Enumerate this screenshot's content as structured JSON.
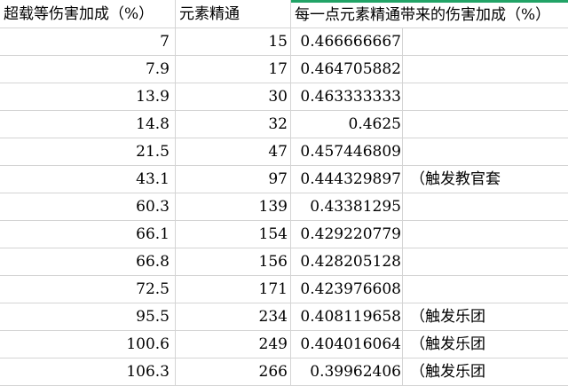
{
  "headers": [
    "超载等伤害加成（%）",
    "元素精通",
    "每一点元素精通带来的伤害加成（%）"
  ],
  "rows": [
    {
      "bonus": "7",
      "mastery": "15",
      "per_point": "0.466666667",
      "note": ""
    },
    {
      "bonus": "7.9",
      "mastery": "17",
      "per_point": "0.464705882",
      "note": ""
    },
    {
      "bonus": "13.9",
      "mastery": "30",
      "per_point": "0.463333333",
      "note": ""
    },
    {
      "bonus": "14.8",
      "mastery": "32",
      "per_point": "0.4625",
      "note": ""
    },
    {
      "bonus": "21.5",
      "mastery": "47",
      "per_point": "0.457446809",
      "note": ""
    },
    {
      "bonus": "43.1",
      "mastery": "97",
      "per_point": "0.444329897",
      "note": "（触发教官套"
    },
    {
      "bonus": "60.3",
      "mastery": "139",
      "per_point": "0.43381295",
      "note": ""
    },
    {
      "bonus": "66.1",
      "mastery": "154",
      "per_point": "0.429220779",
      "note": ""
    },
    {
      "bonus": "66.8",
      "mastery": "156",
      "per_point": "0.428205128",
      "note": ""
    },
    {
      "bonus": "72.5",
      "mastery": "171",
      "per_point": "0.423976608",
      "note": ""
    },
    {
      "bonus": "95.5",
      "mastery": "234",
      "per_point": "0.408119658",
      "note": "（触发乐团"
    },
    {
      "bonus": "100.6",
      "mastery": "249",
      "per_point": "0.404016064",
      "note": "（触发乐团"
    },
    {
      "bonus": "106.3",
      "mastery": "266",
      "per_point": "0.39962406",
      "note": "（触发乐团"
    }
  ],
  "colors": {
    "gridline": "#d4d4d4",
    "active_column_marker": "#21a366",
    "text": "#000000",
    "background": "#ffffff"
  }
}
